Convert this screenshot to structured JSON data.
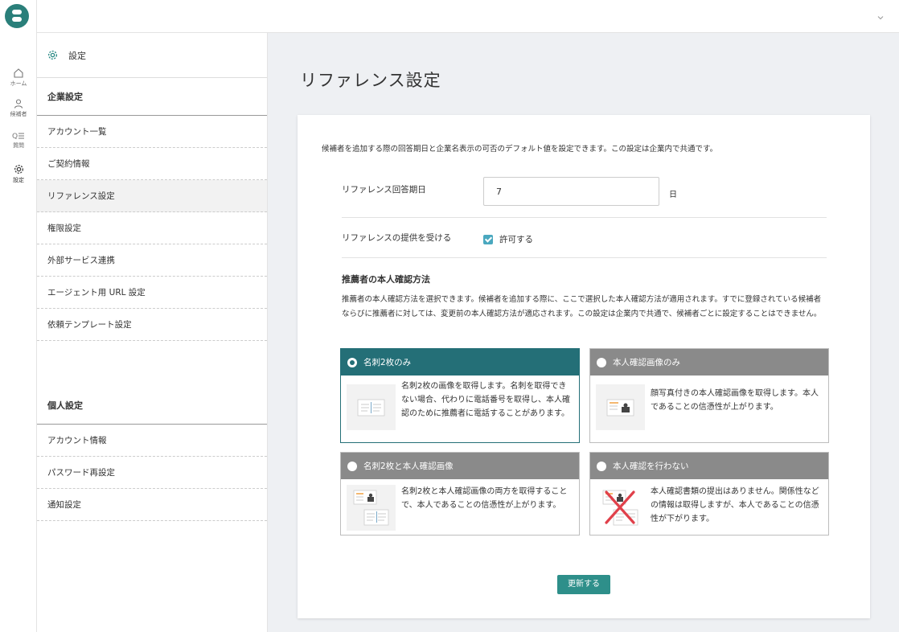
{
  "rail": {
    "items": [
      {
        "label": "ホーム",
        "icon": "home-icon"
      },
      {
        "label": "候補者",
        "icon": "person-icon"
      },
      {
        "label": "質問",
        "icon": "question-list-icon"
      },
      {
        "label": "設定",
        "icon": "gear-icon"
      }
    ]
  },
  "sidebar": {
    "header": "設定",
    "company_section": "企業設定",
    "company_items": [
      "アカウント一覧",
      "ご契約情報",
      "リファレンス設定",
      "権限設定",
      "外部サービス連携",
      "エージェント用 URL 設定",
      "依頼テンプレート設定"
    ],
    "personal_section": "個人設定",
    "personal_items": [
      "アカウント情報",
      "パスワード再設定",
      "通知設定"
    ]
  },
  "main": {
    "title": "リファレンス設定",
    "description": "候補者を追加する際の回答期日と企業名表示の可否のデフォルト値を設定できます。この設定は企業内で共通です。",
    "answer_days": {
      "label": "リファレンス回答期日",
      "value": "7",
      "unit": "日"
    },
    "receive": {
      "label": "リファレンスの提供を受ける",
      "checkbox_label": "許可する",
      "checked": true
    },
    "verification": {
      "title": "推薦者の本人確認方法",
      "description": "推薦者の本人確認方法を選択できます。候補者を追加する際に、ここで選択した本人確認方法が適用されます。すでに登録されている候補者ならびに推薦者に対しては、変更前の本人確認方法が適応されます。この設定は企業内で共通で、候補者ごとに設定することはできません。",
      "options": [
        {
          "title": "名刺2枚のみ",
          "text": "名刺2枚の画像を取得します。名刺を取得できない場合、代わりに電話番号を取得し、本人確認のために推薦者に電話することがあります。",
          "selected": true
        },
        {
          "title": "本人確認画像のみ",
          "text": "顔写真付きの本人確認画像を取得します。本人であることの信憑性が上がります。",
          "selected": false
        },
        {
          "title": "名刺2枚と本人確認画像",
          "text": "名刺2枚と本人確認画像の両方を取得することで、本人であることの信憑性が上がります。",
          "selected": false
        },
        {
          "title": "本人確認を行わない",
          "text": "本人確認書類の提出はありません。関係性などの情報は取得しますが、本人であることの信憑性が下がります。",
          "selected": false
        }
      ]
    },
    "update_button": "更新する"
  },
  "colors": {
    "accent": "#246f77",
    "button": "#2e8f8a",
    "checkbox": "#4aa8bf",
    "unselected_header": "#8a8a8a",
    "background": "#eef0f3"
  }
}
